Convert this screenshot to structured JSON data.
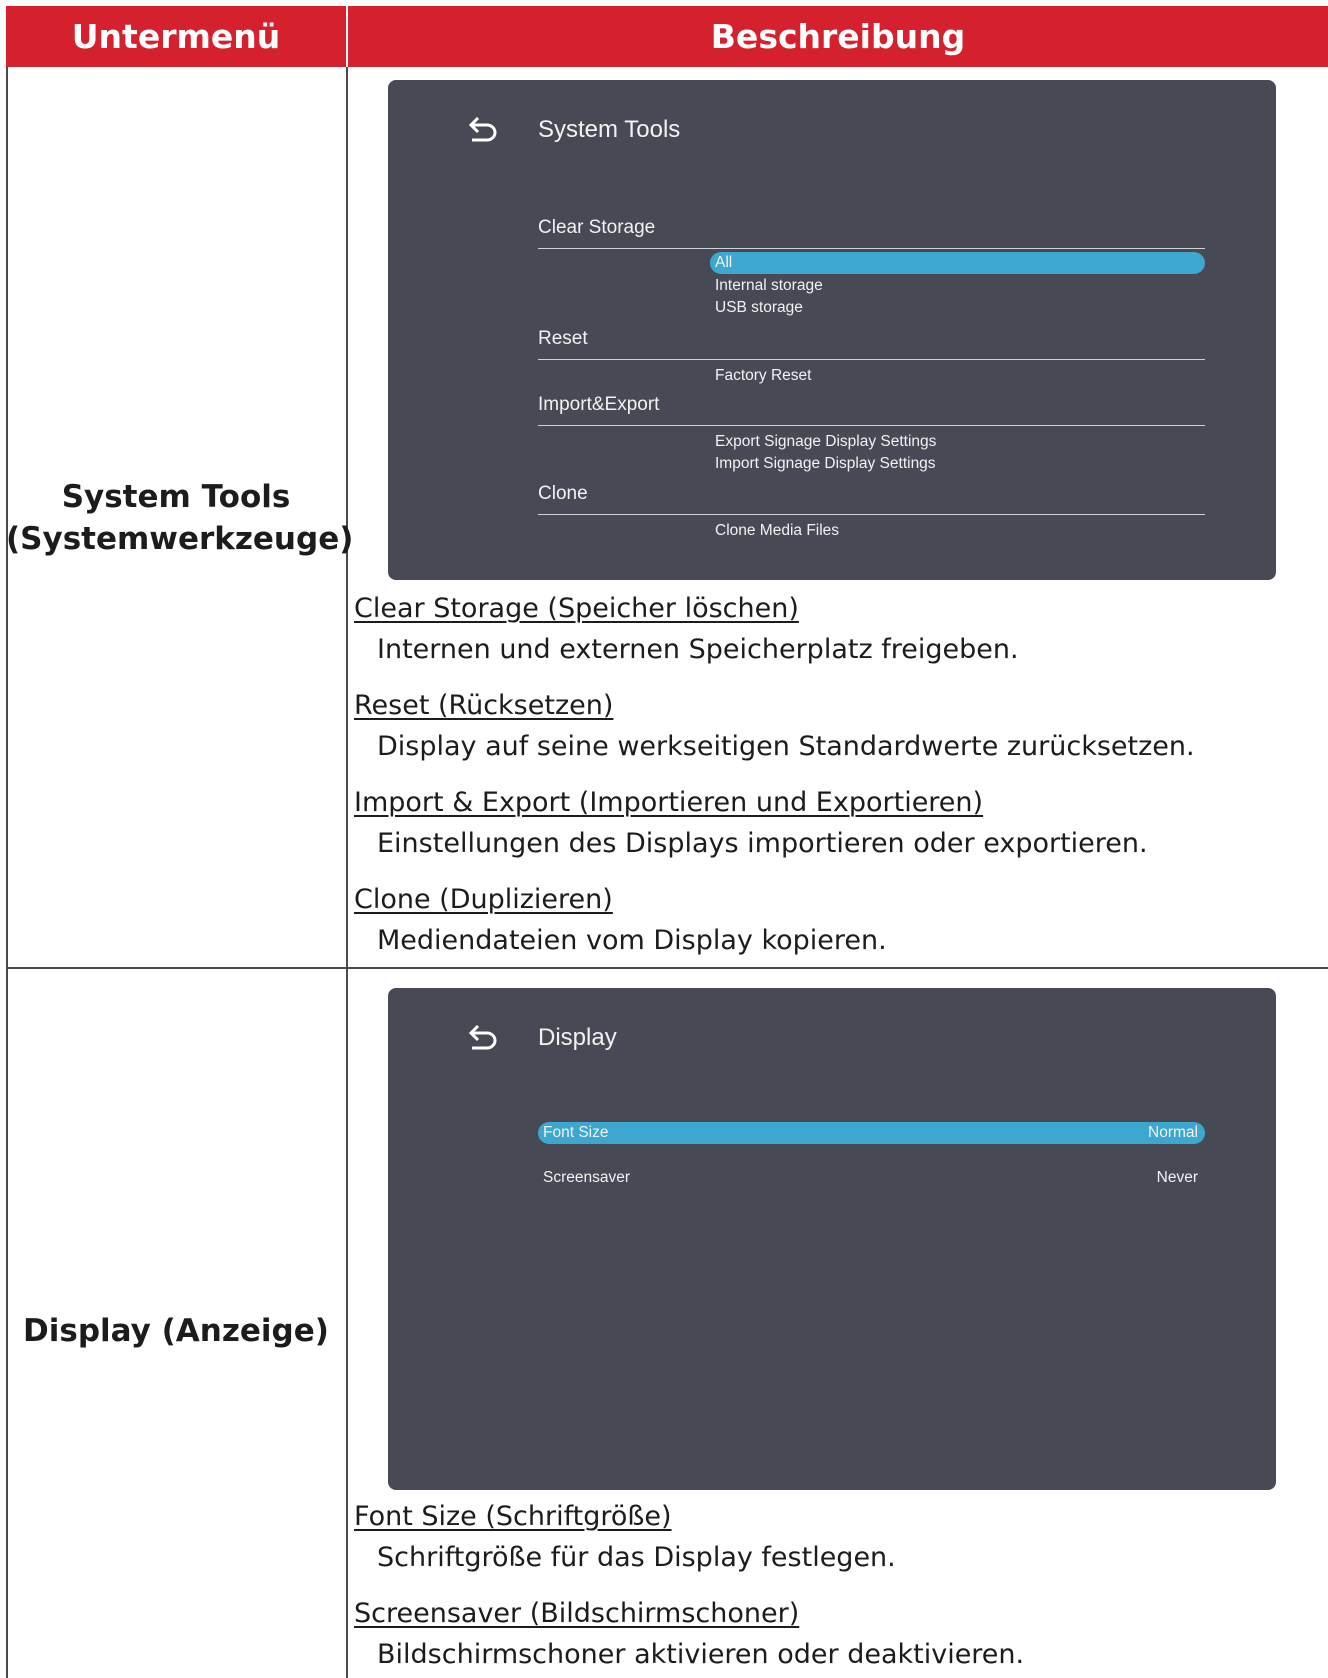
{
  "header": {
    "col1": "Untermenü",
    "col2": "Beschreibung"
  },
  "rows": [
    {
      "label_line1": "System Tools",
      "label_line2": "(Systemwerkzeuge)",
      "screen": {
        "title": "System Tools",
        "sections": [
          {
            "label": "Clear Storage",
            "options": [
              "All",
              "Internal storage",
              "USB storage"
            ],
            "selected": "All"
          },
          {
            "label": "Reset",
            "options": [
              "Factory Reset"
            ]
          },
          {
            "label": "Import&Export",
            "options": [
              "Export Signage Display Settings",
              "Import Signage Display Settings"
            ]
          },
          {
            "label": "Clone",
            "options": [
              "Clone Media Files"
            ]
          }
        ]
      },
      "items": [
        {
          "heading": "Clear Storage (Speicher löschen)",
          "text": "Internen und externen Speicherplatz freigeben."
        },
        {
          "heading": "Reset (Rücksetzen)",
          "text": "Display auf seine werkseitigen Standardwerte zurücksetzen."
        },
        {
          "heading": "Import & Export (Importieren und Exportieren)",
          "text": "Einstellungen des Displays importieren oder exportieren."
        },
        {
          "heading": "Clone (Duplizieren)",
          "text": "Mediendateien vom Display kopieren."
        }
      ]
    },
    {
      "label_line1": "Display (Anzeige)",
      "screen": {
        "title": "Display",
        "settings": [
          {
            "label": "Font Size",
            "value": "Normal",
            "selected": true
          },
          {
            "label": "Screensaver",
            "value": "Never",
            "selected": false
          }
        ]
      },
      "items": [
        {
          "heading": "Font Size (Schriftgröße)",
          "text": "Schriftgröße für das Display festlegen."
        },
        {
          "heading": "Screensaver (Bildschirmschoner)",
          "text": "Bildschirmschoner aktivieren oder deaktivieren."
        }
      ]
    }
  ],
  "colors": {
    "header_bg": "#d4212d",
    "screen_bg": "#474a55",
    "highlight": "#3da7cf"
  },
  "icons": {
    "back": "back-arrow-icon"
  }
}
